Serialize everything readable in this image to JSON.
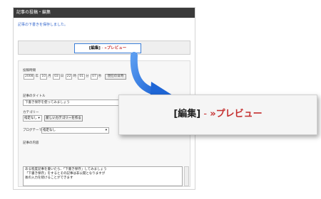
{
  "window": {
    "title": "記事の投稿・編集",
    "notice": "記事の下書きを保存しました。"
  },
  "tabs": {
    "edit_label": "[編集]",
    "separator": " - ",
    "preview_label": "»プレビュー"
  },
  "form": {
    "datetime_label": "投稿時間",
    "year": "2008",
    "year_unit": "年",
    "month": "10",
    "month_unit": "月",
    "day": "03",
    "day_unit": "日",
    "hour": "22",
    "hour_unit": "時",
    "minute": "01",
    "minute_unit": "分",
    "second": "07",
    "second_unit": "秒",
    "now_button": "現在の日時",
    "title_label": "記事のタイトル",
    "title_value": "下書き保存を使ってみましょう",
    "category_label": "カテゴリー",
    "category_value": "指定なし",
    "new_category_button": "新しいカテゴリーを作る",
    "theme_label": "ブログテーマ",
    "theme_value": "指定なし",
    "body_label": "記事の内容",
    "body_lines": [
      "ある程度記事を書いたら、「下書き保存」してみましょう",
      "「下書き保存」をするとその記事は非公開となりますが",
      "後の入力を続けることができます"
    ],
    "swatch_colors": [
      "#2255cc",
      "#d62828",
      "#f2c200",
      "#222222"
    ]
  }
}
